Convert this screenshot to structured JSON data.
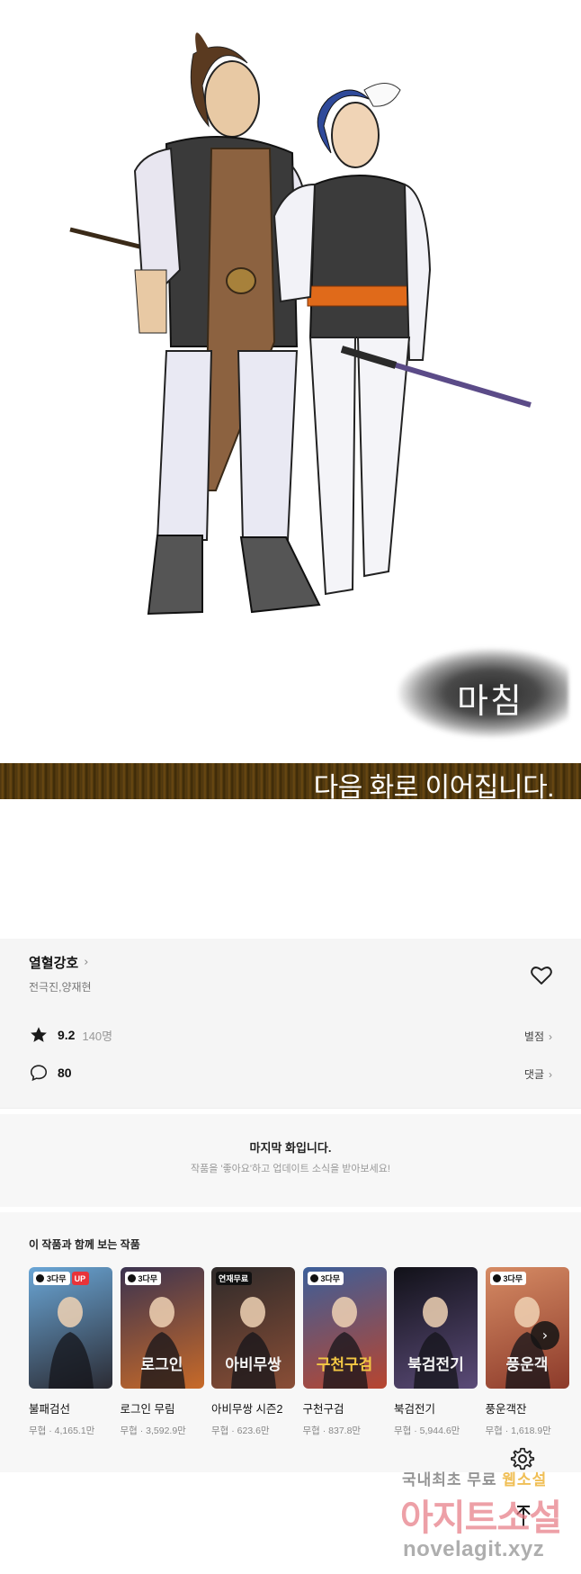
{
  "comic": {
    "ending_mark": "마침",
    "continue_text": "다음 화로 이어집니다."
  },
  "series": {
    "title": "열혈강호",
    "title_chevron": "›",
    "authors": "전극진,양재현",
    "rating": "9.2",
    "rating_count": "140명",
    "rating_link": "별점",
    "comment_count": "80",
    "comment_link": "댓글",
    "link_chevron": "›"
  },
  "notice": {
    "title": "마지막 화입니다.",
    "subtitle": "작품을 '좋아요'하고 업데이트 소식을 받아보세요!"
  },
  "recommendations": {
    "heading": "이 작품과 함께 보는 작품",
    "items": [
      {
        "name": "불패검선",
        "meta": "무협 · 4,165.1만",
        "badge": "3다무",
        "up": "UP",
        "cover": "",
        "colors": [
          "#6aa6d6",
          "#2b2b33"
        ]
      },
      {
        "name": "로그인 무림",
        "meta": "무협 · 3,592.9만",
        "badge": "3다무",
        "cover": "로그인",
        "colors": [
          "#3b3350",
          "#c86a28"
        ]
      },
      {
        "name": "아비무쌍 시즌2",
        "meta": "무협 · 623.6만",
        "badge": "연재무료",
        "cover": "아비무쌍",
        "colors": [
          "#2e2a2a",
          "#8a4e36"
        ]
      },
      {
        "name": "구천구검",
        "meta": "무협 · 837.8만",
        "badge": "3다무",
        "cover": "구천구검",
        "colors": [
          "#3c5f9a",
          "#b8452f"
        ]
      },
      {
        "name": "북검전기",
        "meta": "무협 · 5,944.6만",
        "badge": "",
        "cover": "북검전기",
        "colors": [
          "#111118",
          "#5b4b78"
        ]
      },
      {
        "name": "풍운객잔",
        "meta": "무협 · 1,618.9만",
        "badge": "3다무",
        "cover": "풍운객",
        "colors": [
          "#d68b64",
          "#8c3a2a"
        ]
      }
    ],
    "next_icon": "chevron-right-icon"
  },
  "watermark": {
    "line1_a": "국내최초 무료 ",
    "line1_b": "웹소설",
    "line2": "아지트소설",
    "line3": "novelagit.xyz"
  }
}
